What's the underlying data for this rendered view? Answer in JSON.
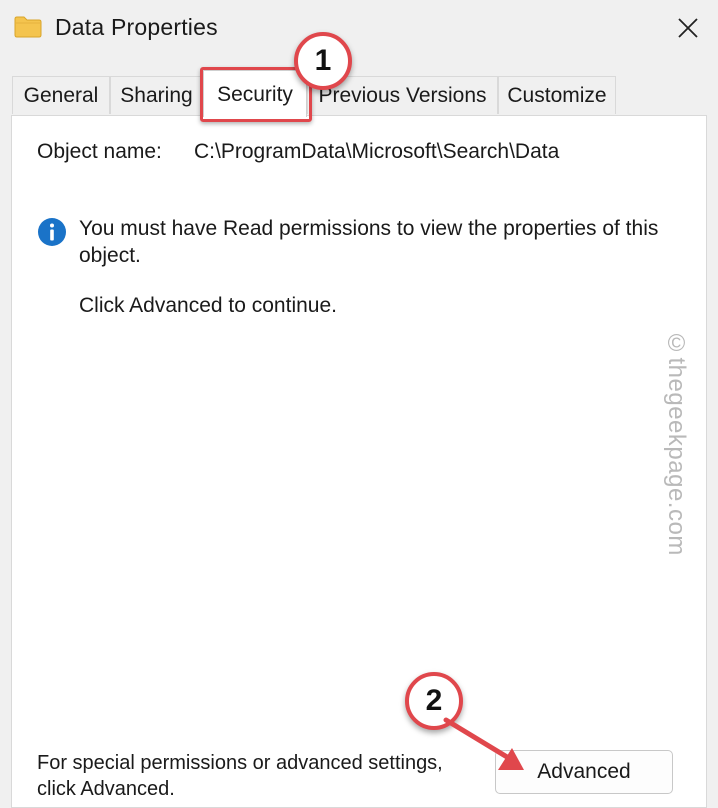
{
  "window": {
    "title": "Data Properties",
    "close_label": "×"
  },
  "tabs": [
    {
      "label": "General"
    },
    {
      "label": "Sharing"
    },
    {
      "label": "Security"
    },
    {
      "label": "Previous Versions"
    },
    {
      "label": "Customize"
    }
  ],
  "active_tab": "Security",
  "object": {
    "label": "Object name:",
    "value": "C:\\ProgramData\\Microsoft\\Search\\Data"
  },
  "info": {
    "message": "You must have Read permissions to view the properties of this object.",
    "continue": "Click Advanced to continue."
  },
  "footer": {
    "text": "For special permissions or advanced settings, click Advanced.",
    "advanced_button": "Advanced"
  },
  "annotations": {
    "step1": "1",
    "step2": "2"
  },
  "watermark": "©thegeekpage.com",
  "colors": {
    "annotation": "#e0474c",
    "info": "#1a73c8",
    "folder": "#f4c44e"
  },
  "icons": {
    "window": "folder-icon",
    "close": "close-icon",
    "info": "info-icon"
  }
}
